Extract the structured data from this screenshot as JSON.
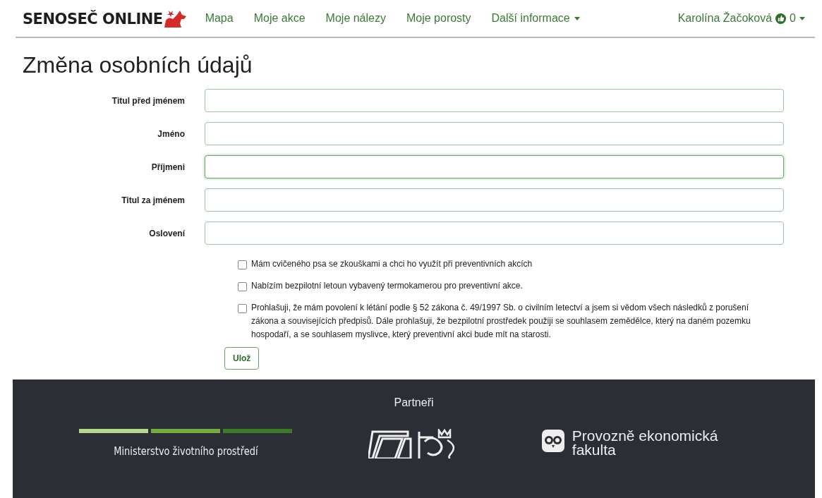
{
  "header": {
    "logo": "SENOSEČ ONLINE",
    "nav": [
      {
        "label": "Mapa",
        "kind": "link"
      },
      {
        "label": "Moje akce",
        "kind": "link"
      },
      {
        "label": "Moje nálezy",
        "kind": "link"
      },
      {
        "label": "Moje porosty",
        "kind": "link"
      },
      {
        "label": "Další informace",
        "kind": "dropdown"
      }
    ],
    "user": {
      "name": "Karolína Žačoková",
      "count": "0"
    }
  },
  "title": "Změna osobních údajů",
  "fields": [
    {
      "label": "Titul před jménem",
      "focused": false
    },
    {
      "label": "Jméno",
      "focused": false
    },
    {
      "label": "Příjmeni",
      "focused": true
    },
    {
      "label": "Titul za jménem",
      "focused": false
    },
    {
      "label": "Oslovení",
      "focused": false
    }
  ],
  "checkboxes": [
    {
      "label": "Mám cvičeného psa se zkouškami a chci ho využít při preventivních akcích",
      "checked": false
    },
    {
      "label": "Nabízím bezpilotní letoun vybavený termokamerou pro preventivní akce.",
      "checked": false
    },
    {
      "label": "Prohlašuji, že mám povolení k létání podle § 52 zákona č. 49/1997 Sb. o civilním letectví a jsem si vědom všech následků z porušení zákona a souvisejících předpisů. Dále prohlašuji, že bezpilotní prostředek použiji se souhlasem zemědělce, který na daném pozemku hospodaří, a se souhlasem myslivce, který preventivní akci bude mít na starosti.",
      "checked": false
    }
  ],
  "save_button": "Ulož",
  "footer": {
    "title": "Partneři",
    "partners": [
      {
        "kind": "ministry",
        "name": "Ministerstvo životního prostředí"
      },
      {
        "kind": "crest"
      },
      {
        "kind": "faculty",
        "name": "Provozně ekonomická fakulta"
      }
    ]
  }
}
